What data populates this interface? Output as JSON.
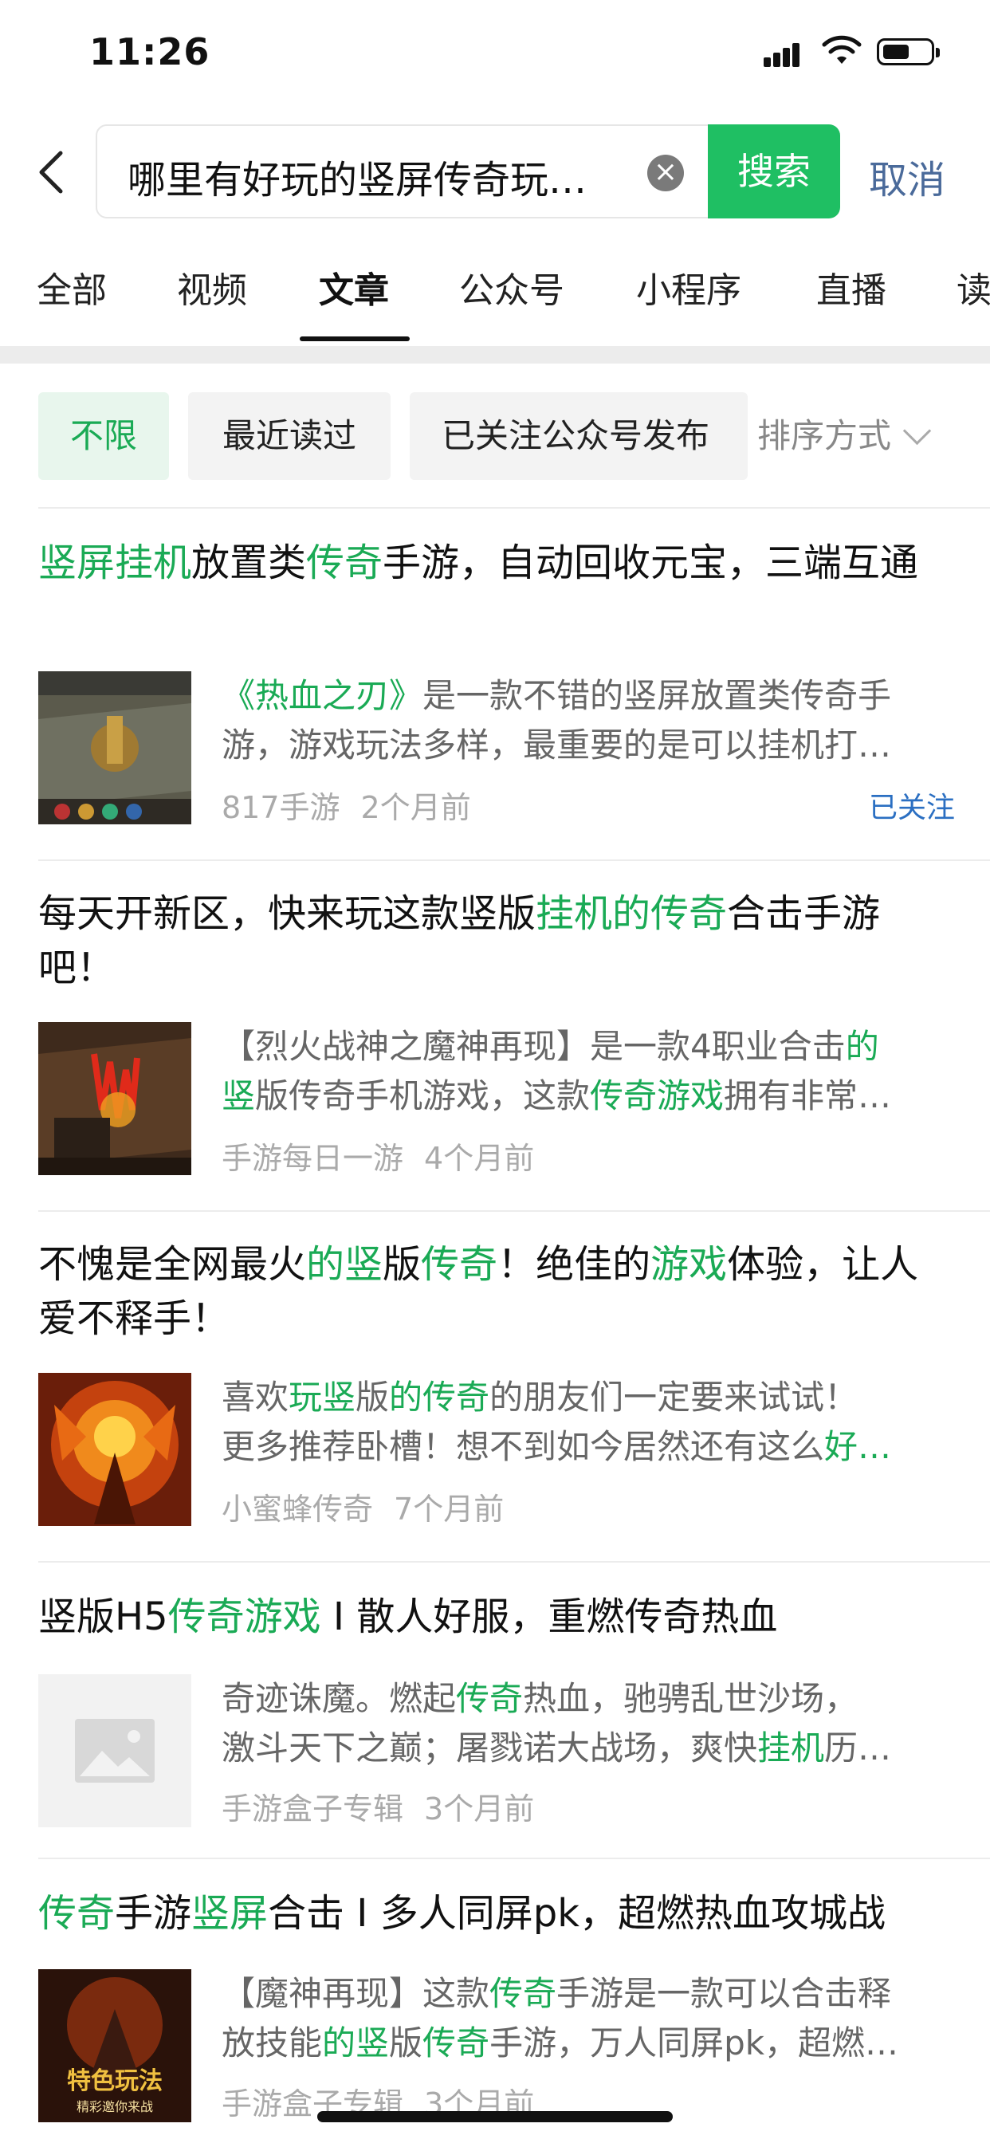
{
  "status_bar": {
    "time": "11:26"
  },
  "search": {
    "query": "哪里有好玩的竖屏传奇玩…",
    "button_label": "搜索",
    "cancel_label": "取消"
  },
  "tabs": [
    {
      "label": "全部"
    },
    {
      "label": "视频"
    },
    {
      "label": "文章",
      "active": true
    },
    {
      "label": "公众号"
    },
    {
      "label": "小程序"
    },
    {
      "label": "直播"
    },
    {
      "label": "读"
    }
  ],
  "filters": {
    "chips": [
      {
        "label": "不限",
        "active": true
      },
      {
        "label": "最近读过"
      },
      {
        "label": "已关注公众号发布"
      }
    ],
    "sort_label": "排序方式"
  },
  "colors": {
    "accent": "#1aaa55",
    "button": "#1fbf63",
    "link": "#2b6fc2",
    "cancel": "#4a6a9a"
  },
  "articles": [
    {
      "title": [
        {
          "t": "竖屏挂机",
          "h": true
        },
        {
          "t": "放置类"
        },
        {
          "t": "传奇",
          "h": true
        },
        {
          "t": "手游，自动回收元宝，三端互通"
        }
      ],
      "desc1": [
        {
          "t": "《热血之刃》",
          "h": true
        },
        {
          "t": "是一款不错的竖屏放置类传奇手"
        }
      ],
      "desc2": [
        {
          "t": "游，游戏玩法多样，最重要的是可以挂机打…"
        }
      ],
      "source": "817手游",
      "time": "2个月前",
      "followed": "已关注",
      "thumb": "game-screenshot-battle"
    },
    {
      "title": [
        {
          "t": "每天开新区，快来玩这款竖版"
        },
        {
          "t": "挂机的传奇",
          "h": true
        },
        {
          "t": "合击手游吧！"
        }
      ],
      "desc1": [
        {
          "t": "【烈火战神之魔神再现】是一款4职业合击"
        },
        {
          "t": "的",
          "h": true
        }
      ],
      "desc2": [
        {
          "t": "竖",
          "h": true
        },
        {
          "t": "版传奇手机游戏，这款"
        },
        {
          "t": "传奇游戏",
          "h": true
        },
        {
          "t": "拥有非常…"
        }
      ],
      "source": "手游每日一游",
      "time": "4个月前",
      "thumb": "game-screenshot-fire"
    },
    {
      "title": [
        {
          "t": "不愧是全网最火"
        },
        {
          "t": "的竖",
          "h": true
        },
        {
          "t": "版"
        },
        {
          "t": "传奇",
          "h": true
        },
        {
          "t": "！绝佳的"
        },
        {
          "t": "游戏",
          "h": true
        },
        {
          "t": "体验，让人爱不释手！"
        }
      ],
      "desc1": [
        {
          "t": "喜欢"
        },
        {
          "t": "玩竖",
          "h": true
        },
        {
          "t": "版"
        },
        {
          "t": "的传奇",
          "h": true
        },
        {
          "t": "的朋友们一定要来试试！"
        }
      ],
      "desc2": [
        {
          "t": "更多推荐卧槽！想不到如今居然还有这么"
        },
        {
          "t": "好…",
          "h": true
        }
      ],
      "source": "小蜜蜂传奇",
      "time": "7个月前",
      "thumb": "game-art-flame-warrior"
    },
    {
      "title": [
        {
          "t": "竖版H5"
        },
        {
          "t": "传奇游戏",
          "h": true
        },
        {
          "t": " I 散人好服，重燃传奇热血"
        }
      ],
      "desc1": [
        {
          "t": "奇迹诛魔。燃起"
        },
        {
          "t": "传奇",
          "h": true
        },
        {
          "t": "热血，驰骋乱世沙场，"
        }
      ],
      "desc2": [
        {
          "t": "激斗天下之巅；屠戮诺大战场，爽快"
        },
        {
          "t": "挂机",
          "h": true
        },
        {
          "t": "历…"
        }
      ],
      "source": "手游盒子专辑",
      "time": "3个月前",
      "thumb": "image-placeholder-icon"
    },
    {
      "title": [
        {
          "t": "传奇",
          "h": true
        },
        {
          "t": "手游"
        },
        {
          "t": "竖屏",
          "h": true
        },
        {
          "t": "合击 I 多人同屏pk，超燃热血攻城战"
        }
      ],
      "desc1": [
        {
          "t": "【魔神再现】这款"
        },
        {
          "t": "传奇",
          "h": true
        },
        {
          "t": "手游是一款可以合击释"
        }
      ],
      "desc2": [
        {
          "t": "放技能"
        },
        {
          "t": "的竖",
          "h": true
        },
        {
          "t": "版"
        },
        {
          "t": "传奇",
          "h": true
        },
        {
          "t": "手游，万人同屏pk，超燃…"
        }
      ],
      "source": "手游盒子专辑",
      "time": "3个月前",
      "thumb": "game-poster-tese",
      "thumb_text": "特色玩法",
      "thumb_sub": "精彩邀你来战"
    }
  ]
}
